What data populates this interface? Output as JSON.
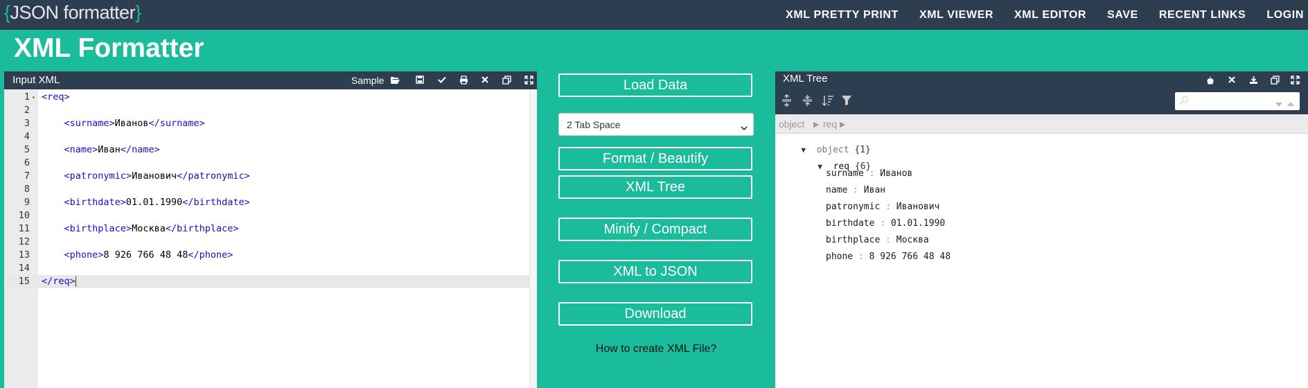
{
  "logo": {
    "open_brace": "{",
    "text": "JSON formatter",
    "close_brace": "}"
  },
  "nav": [
    "XML PRETTY PRINT",
    "XML VIEWER",
    "XML EDITOR",
    "SAVE",
    "RECENT LINKS",
    "LOGIN"
  ],
  "page_title": "XML Formatter",
  "input_panel": {
    "title": "Input XML",
    "sample_label": "Sample",
    "tools": [
      "folder-open-icon",
      "save-icon",
      "check-icon",
      "print-icon",
      "close-icon",
      "copy-icon",
      "expand-icon"
    ]
  },
  "editor": {
    "lines": [
      {
        "num": "1",
        "code": "<req>"
      },
      {
        "num": "2",
        "code": ""
      },
      {
        "num": "3",
        "code": "    <surname>Иванов</surname>"
      },
      {
        "num": "4",
        "code": ""
      },
      {
        "num": "5",
        "code": "    <name>Иван</name>"
      },
      {
        "num": "6",
        "code": ""
      },
      {
        "num": "7",
        "code": "    <patronymic>Иванович</patronymic>"
      },
      {
        "num": "8",
        "code": ""
      },
      {
        "num": "9",
        "code": "    <birthdate>01.01.1990</birthdate>"
      },
      {
        "num": "10",
        "code": ""
      },
      {
        "num": "11",
        "code": "    <birthplace>Москва</birthplace>"
      },
      {
        "num": "12",
        "code": ""
      },
      {
        "num": "13",
        "code": "    <phone>8 926 766 48 48</phone>"
      },
      {
        "num": "14",
        "code": ""
      },
      {
        "num": "15",
        "code": "</req>"
      }
    ],
    "active_line": "15"
  },
  "actions": {
    "load_data": "Load Data",
    "indent_select": "2 Tab Space",
    "format": "Format / Beautify",
    "xml_tree": "XML Tree",
    "minify": "Minify / Compact",
    "to_json": "XML to JSON",
    "download": "Download",
    "how_to": "How to create XML File?"
  },
  "tree_panel": {
    "title": "XML Tree",
    "breadcrumb": [
      "object",
      "req"
    ],
    "root": {
      "label": "object",
      "count": "{1}"
    },
    "child": {
      "label": "req",
      "count": "{6}"
    },
    "fields": [
      {
        "key": "surname",
        "value": "Иванов"
      },
      {
        "key": "name",
        "value": "Иван"
      },
      {
        "key": "patronymic",
        "value": "Иванович"
      },
      {
        "key": "birthdate",
        "value": "01.01.1990"
      },
      {
        "key": "birthplace",
        "value": "Москва"
      },
      {
        "key": "phone",
        "value": "8 926 766 48 48"
      }
    ]
  },
  "colors": {
    "accent": "#1abc9c",
    "navbar": "#2c3e50",
    "tag": "#170ec4"
  }
}
